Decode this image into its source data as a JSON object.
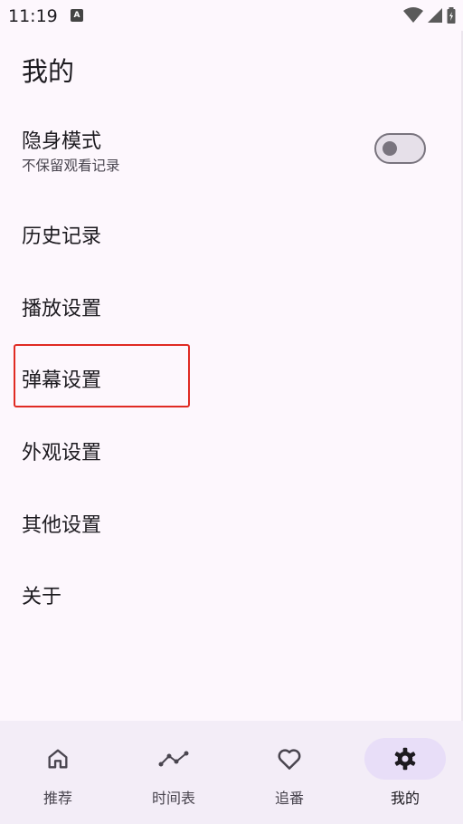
{
  "status": {
    "time": "11:19",
    "app_icon_letter": "A",
    "icons": [
      "wifi-icon",
      "signal-icon",
      "battery-icon"
    ]
  },
  "page": {
    "title": "我的"
  },
  "settings": {
    "incognito": {
      "label": "隐身模式",
      "sublabel": "不保留观看记录",
      "enabled": false
    },
    "items": [
      {
        "label": "历史记录"
      },
      {
        "label": "播放设置"
      },
      {
        "label": "弹幕设置"
      },
      {
        "label": "外观设置"
      },
      {
        "label": "其他设置"
      },
      {
        "label": "关于"
      }
    ]
  },
  "bottom_nav": {
    "items": [
      {
        "label": "推荐",
        "icon": "home-icon",
        "active": false
      },
      {
        "label": "时间表",
        "icon": "timeline-icon",
        "active": false
      },
      {
        "label": "追番",
        "icon": "heart-icon",
        "active": false
      },
      {
        "label": "我的",
        "icon": "gear-icon",
        "active": true
      }
    ]
  },
  "colors": {
    "background": "#fdf7fd",
    "nav_background": "#f3edf7",
    "active_indicator": "#e8def8",
    "highlight": "#e02b23"
  }
}
